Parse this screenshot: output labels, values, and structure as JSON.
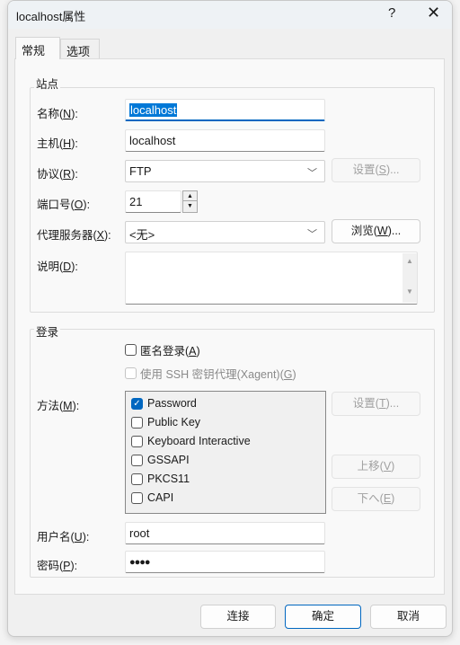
{
  "window": {
    "title": "localhost属性",
    "help": "?",
    "close": "✕"
  },
  "tabs": [
    {
      "label": "常规",
      "active": true
    },
    {
      "label": "选项",
      "active": false
    }
  ],
  "site": {
    "group_label": "站点",
    "name": {
      "pre": "名称(",
      "key": "N",
      "post": "):",
      "value": "localhost"
    },
    "host": {
      "pre": "主机(",
      "key": "H",
      "post": "):",
      "value": "localhost"
    },
    "protocol": {
      "pre": "协议(",
      "key": "R",
      "post": "):",
      "value": "FTP",
      "settings_button": {
        "pre": "设置(",
        "key": "S",
        "post": ")..."
      }
    },
    "port": {
      "pre": "端口号(",
      "key": "O",
      "post": "):",
      "value": "21"
    },
    "proxy": {
      "pre": "代理服务器(",
      "key": "X",
      "post": "):",
      "value": "<无>",
      "browse_button": {
        "pre": "浏览(",
        "key": "W",
        "post": ")..."
      }
    },
    "description": {
      "pre": "说明(",
      "key": "D",
      "post": "):",
      "value": ""
    }
  },
  "login": {
    "group_label": "登录",
    "anonymous": {
      "pre": "匿名登录(",
      "key": "A",
      "post": ")",
      "checked": false
    },
    "ssh_agent": {
      "pre": "使用 SSH 密钥代理(Xagent)(",
      "key": "G",
      "post": ")",
      "checked": false,
      "disabled": true
    },
    "method": {
      "pre": "方法(",
      "key": "M",
      "post": "):"
    },
    "methods": [
      {
        "label": "Password",
        "checked": true
      },
      {
        "label": "Public Key",
        "checked": false
      },
      {
        "label": "Keyboard Interactive",
        "checked": false
      },
      {
        "label": "GSSAPI",
        "checked": false
      },
      {
        "label": "PKCS11",
        "checked": false
      },
      {
        "label": "CAPI",
        "checked": false
      }
    ],
    "settings_button": {
      "pre": "设置(",
      "key": "T",
      "post": ")..."
    },
    "up_button": {
      "pre": "上移(",
      "key": "V",
      "post": ")"
    },
    "down_button": {
      "pre": "下へ(",
      "key": "E",
      "post": ")"
    },
    "username": {
      "pre": "用户名(",
      "key": "U",
      "post": "):",
      "value": "root"
    },
    "password": {
      "pre": "密码(",
      "key": "P",
      "post": "):",
      "value": "●●●●"
    }
  },
  "footer": {
    "connect": "连接",
    "ok": "确定",
    "cancel": "取消"
  },
  "colors": {
    "accent": "#0067c0"
  }
}
